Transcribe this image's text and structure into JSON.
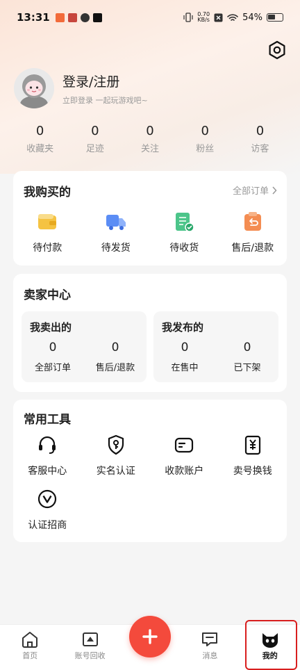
{
  "status_bar": {
    "time": "13:31",
    "net_speed_value": "0.70",
    "net_speed_unit": "KB/s",
    "battery": "54%"
  },
  "profile": {
    "title": "登录/注册",
    "subtitle": "立即登录 一起玩游戏吧~"
  },
  "stats": [
    {
      "value": "0",
      "label": "收藏夹"
    },
    {
      "value": "0",
      "label": "足迹"
    },
    {
      "value": "0",
      "label": "关注"
    },
    {
      "value": "0",
      "label": "粉丝"
    },
    {
      "value": "0",
      "label": "访客"
    }
  ],
  "orders": {
    "title": "我购买的",
    "all_label": "全部订单",
    "items": [
      {
        "label": "待付款",
        "icon": "wallet-icon",
        "color": "#f5c342"
      },
      {
        "label": "待发货",
        "icon": "truck-icon",
        "color": "#5b8df5"
      },
      {
        "label": "待收货",
        "icon": "receipt-check-icon",
        "color": "#4cc58a"
      },
      {
        "label": "售后/退款",
        "icon": "return-icon",
        "color": "#f48d52"
      }
    ]
  },
  "seller": {
    "title": "卖家中心",
    "sold": {
      "title": "我卖出的",
      "items": [
        {
          "value": "0",
          "label": "全部订单"
        },
        {
          "value": "0",
          "label": "售后/退款"
        }
      ]
    },
    "published": {
      "title": "我发布的",
      "items": [
        {
          "value": "0",
          "label": "在售中"
        },
        {
          "value": "0",
          "label": "已下架"
        }
      ]
    }
  },
  "tools": {
    "title": "常用工具",
    "items": [
      {
        "label": "客服中心",
        "icon": "headset-icon"
      },
      {
        "label": "实名认证",
        "icon": "id-shield-icon"
      },
      {
        "label": "收款账户",
        "icon": "wallet-card-icon"
      },
      {
        "label": "卖号换钱",
        "icon": "yuan-icon"
      },
      {
        "label": "认证招商",
        "icon": "v-badge-icon"
      }
    ]
  },
  "tabbar": {
    "items": [
      {
        "label": "首页",
        "icon": "home-icon"
      },
      {
        "label": "账号回收",
        "icon": "recycle-box-icon"
      },
      {
        "label": "",
        "icon": "plus-icon"
      },
      {
        "label": "消息",
        "icon": "message-icon"
      },
      {
        "label": "我的",
        "icon": "cat-avatar-icon"
      }
    ],
    "active_index": 4
  },
  "colors": {
    "accent": "#f44a3c",
    "highlight_frame": "#d81e1e"
  }
}
